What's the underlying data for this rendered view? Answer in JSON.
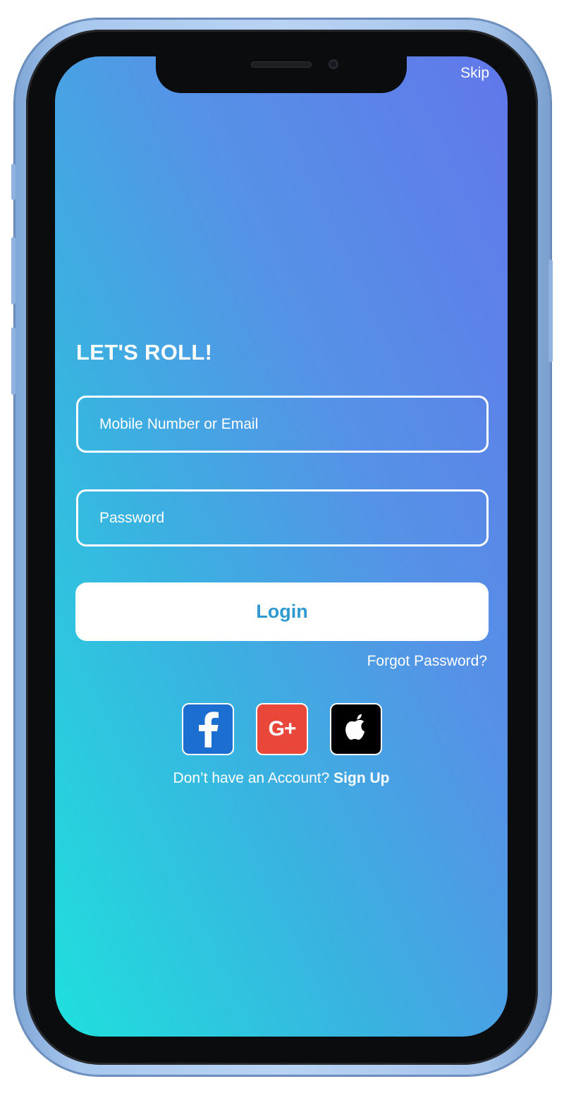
{
  "header": {
    "skip_label": "Skip"
  },
  "login": {
    "title": "LET'S ROLL!",
    "identifier_placeholder": "Mobile Number or Email",
    "password_placeholder": "Password",
    "login_label": "Login",
    "forgot_password": "Forgot Password?"
  },
  "social": {
    "items": [
      {
        "icon": "facebook-icon",
        "color": "#1c6fd1"
      },
      {
        "icon": "google-plus-icon",
        "color": "#e8473a",
        "glyph": "G+"
      },
      {
        "icon": "apple-icon",
        "color": "#000000"
      }
    ]
  },
  "signup": {
    "prompt": "Don’t have an Account?",
    "link_label": "Sign Up"
  },
  "theme": {
    "gradient_top": "#6177ea",
    "gradient_bottom": "#1fe0dd",
    "accent": "#2e9ad0"
  }
}
